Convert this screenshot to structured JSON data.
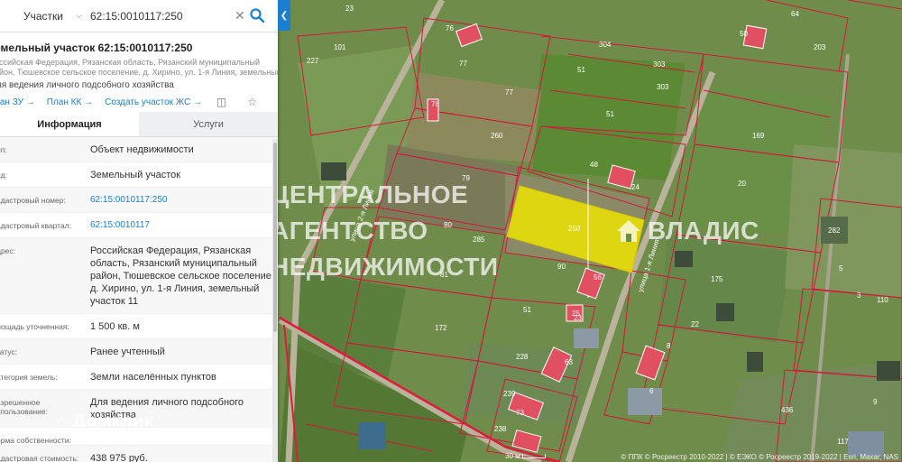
{
  "search": {
    "layer": "Участки",
    "query": "62:15:0010117:250"
  },
  "parcel": {
    "title": "емельный участок 62:15:0010117:250",
    "address_lines": [
      "оссийская Федерация, Рязанская область, Рязанский муниципальный",
      "айон, Тюшевское сельское поселение, д. Хирино, ул. 1-я Линия, земельный участок"
    ],
    "purpose_short": "ля ведения личного подсобного хозяйства"
  },
  "links": {
    "plan_zu": "лан ЗУ →",
    "plan_kk": "План КК →",
    "create_zhs": "Создать участок ЖС →"
  },
  "tabs": {
    "info": "Информация",
    "services": "Услуги"
  },
  "info_rows": [
    {
      "label": "ип:",
      "value": "Объект недвижимости"
    },
    {
      "label": "ид:",
      "value": "Земельный участок"
    },
    {
      "label": "адастровый номер:",
      "value": "62:15:0010117:250"
    },
    {
      "label": "адастровый квартал:",
      "value": "62:15:0010117"
    },
    {
      "label": "дрес:",
      "value": "Российская Федерация, Рязанская область, Рязанский муниципальный район, Тюшевское сельское поселение, д. Хирино, ул. 1-я Линия, земельный участок 11"
    },
    {
      "label": "лощадь уточненная:",
      "value": "1 500 кв. м"
    },
    {
      "label": "татус:",
      "value": "Ранее учтенный"
    },
    {
      "label": "атегория земель:",
      "value": "Земли населённых пунктов"
    },
    {
      "label": "азрешенное спользование:",
      "value": "Для ведения личного подсобного хозяйства"
    },
    {
      "label": "орма собственности:",
      "value": ""
    },
    {
      "label": "адастровая стоимость:",
      "value": "438 975 руб."
    }
  ],
  "map": {
    "highlight_color": "#f2e600",
    "boundary_color": "#d4163c",
    "parcel_numbers": [
      "23",
      "76",
      "64",
      "101",
      "227",
      "77",
      "304",
      "303",
      "203",
      "78",
      "77",
      "51",
      "303",
      "260",
      "51",
      "169",
      "79",
      "48",
      "20",
      "80",
      "250",
      "282",
      "285",
      "90",
      "175",
      "110",
      "81",
      "56",
      "51",
      "22",
      "172",
      "23",
      "228",
      "8",
      "63",
      "239",
      "6",
      "436",
      "238",
      "117",
      "9",
      "5",
      "3",
      "24",
      "50",
      "73",
      "25"
    ],
    "street_labels": [
      "улица 2-я Линия",
      "улица 1-я Линия"
    ]
  },
  "watermarks": {
    "agency": [
      "ЦЕНТРАЛЬНОЕ",
      "АГЕНТСТВО",
      "НЕДВИЖИМОСТИ"
    ],
    "vladis": "ВЛАДИС",
    "domclick": "Домклик"
  },
  "scale_label": "30 м",
  "copyright": "© ППК © Росреестр 2010-2022 | © ЕЭКО © Росреестр 2019-2022 | Esri, Maxar, NAS"
}
